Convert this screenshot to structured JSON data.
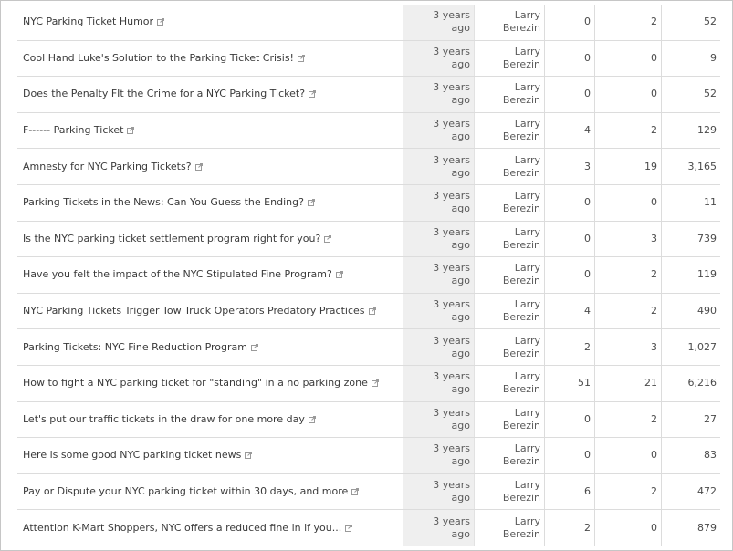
{
  "rows": [
    {
      "title": "NYC Parking Ticket Humor",
      "when": [
        "3 years",
        "ago"
      ],
      "author": [
        "Larry",
        "Berezin"
      ],
      "col1": "0",
      "col2": "2",
      "col3": "52"
    },
    {
      "title": "Cool Hand Luke's Solution to the Parking Ticket Crisis!",
      "when": [
        "3 years",
        "ago"
      ],
      "author": [
        "Larry",
        "Berezin"
      ],
      "col1": "0",
      "col2": "0",
      "col3": "9"
    },
    {
      "title": "Does the Penalty FIt the Crime for a NYC Parking Ticket?",
      "when": [
        "3 years",
        "ago"
      ],
      "author": [
        "Larry",
        "Berezin"
      ],
      "col1": "0",
      "col2": "0",
      "col3": "52"
    },
    {
      "title": "F------ Parking Ticket",
      "when": [
        "3 years",
        "ago"
      ],
      "author": [
        "Larry",
        "Berezin"
      ],
      "col1": "4",
      "col2": "2",
      "col3": "129"
    },
    {
      "title": "Amnesty for NYC Parking Tickets?",
      "when": [
        "3 years",
        "ago"
      ],
      "author": [
        "Larry",
        "Berezin"
      ],
      "col1": "3",
      "col2": "19",
      "col3": "3,165"
    },
    {
      "title": "Parking Tickets in the News: Can You Guess the Ending?",
      "when": [
        "3 years",
        "ago"
      ],
      "author": [
        "Larry",
        "Berezin"
      ],
      "col1": "0",
      "col2": "0",
      "col3": "11"
    },
    {
      "title": "Is the NYC parking ticket settlement program right for you?",
      "when": [
        "3 years",
        "ago"
      ],
      "author": [
        "Larry",
        "Berezin"
      ],
      "col1": "0",
      "col2": "3",
      "col3": "739"
    },
    {
      "title": "Have you felt the impact of the NYC Stipulated Fine Program?",
      "when": [
        "3 years",
        "ago"
      ],
      "author": [
        "Larry",
        "Berezin"
      ],
      "col1": "0",
      "col2": "2",
      "col3": "119"
    },
    {
      "title": "NYC Parking Tickets Trigger Tow Truck Operators Predatory Practices",
      "when": [
        "3 years",
        "ago"
      ],
      "author": [
        "Larry",
        "Berezin"
      ],
      "col1": "4",
      "col2": "2",
      "col3": "490"
    },
    {
      "title": "Parking Tickets: NYC Fine Reduction Program",
      "when": [
        "3 years",
        "ago"
      ],
      "author": [
        "Larry",
        "Berezin"
      ],
      "col1": "2",
      "col2": "3",
      "col3": "1,027"
    },
    {
      "title": "How to fight a NYC parking ticket for \"standing\" in a no parking zone",
      "when": [
        "3 years",
        "ago"
      ],
      "author": [
        "Larry",
        "Berezin"
      ],
      "col1": "51",
      "col2": "21",
      "col3": "6,216"
    },
    {
      "title": "Let's put our traffic tickets in the draw for one more day",
      "when": [
        "3 years",
        "ago"
      ],
      "author": [
        "Larry",
        "Berezin"
      ],
      "col1": "0",
      "col2": "2",
      "col3": "27"
    },
    {
      "title": "Here is some good NYC parking ticket news",
      "when": [
        "3 years",
        "ago"
      ],
      "author": [
        "Larry",
        "Berezin"
      ],
      "col1": "0",
      "col2": "0",
      "col3": "83"
    },
    {
      "title": "Pay or Dispute your NYC parking ticket within 30 days, and more",
      "when": [
        "3 years",
        "ago"
      ],
      "author": [
        "Larry",
        "Berezin"
      ],
      "col1": "6",
      "col2": "2",
      "col3": "472"
    },
    {
      "title": "Attention K-Mart Shoppers, NYC offers a reduced fine in if you...",
      "when": [
        "3 years",
        "ago"
      ],
      "author": [
        "Larry",
        "Berezin"
      ],
      "col1": "2",
      "col2": "0",
      "col3": "879"
    }
  ],
  "icons": {
    "external_link": "external-link-icon"
  },
  "colors": {
    "when_column_bg": "#efefef",
    "row_divider": "#dcdcdc",
    "text": "#4a4a4a"
  }
}
